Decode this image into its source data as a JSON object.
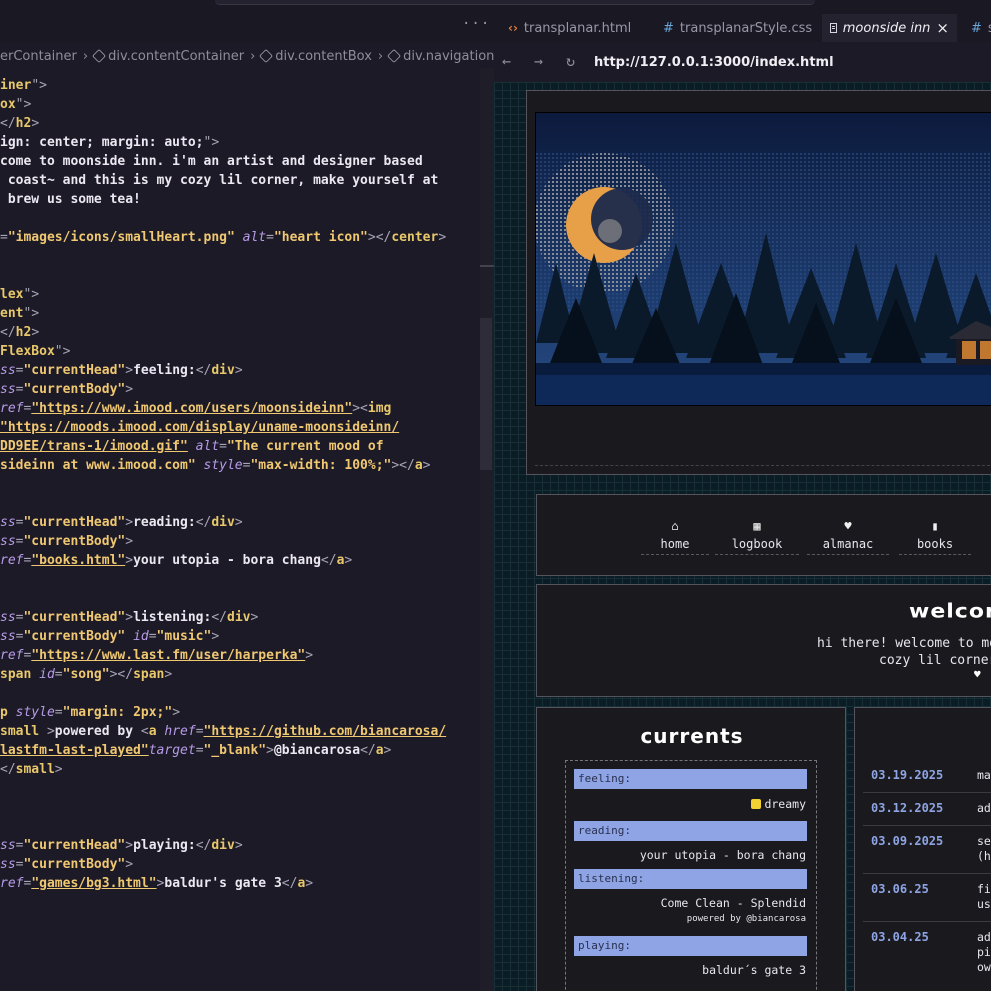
{
  "tabs": {
    "more": "···",
    "items": [
      {
        "label": "transplanar.html",
        "icon": "html-file-icon"
      },
      {
        "label": "transplanarStyle.css",
        "icon": "css-file-icon"
      },
      {
        "label": "moonside inn",
        "icon": "preview-icon",
        "active": true
      },
      {
        "label": "s",
        "icon": "css-file-icon"
      }
    ]
  },
  "breadcrumb": [
    "erContainer",
    "div.contentContainer",
    "div.contentBox",
    "div.navigation",
    "c"
  ],
  "editor": {
    "lines": [
      [
        {
          "k": "t",
          "v": "iner"
        },
        {
          "k": "p",
          "v": "\">"
        }
      ],
      [
        {
          "k": "t",
          "v": "ox"
        },
        {
          "k": "p",
          "v": "\">"
        }
      ],
      [
        {
          "k": "p",
          "v": "</"
        },
        {
          "k": "t",
          "v": "h2"
        },
        {
          "k": "p",
          "v": ">"
        }
      ],
      [
        {
          "k": "x",
          "v": "ign: center; margin: auto;"
        },
        {
          "k": "p",
          "v": "\">"
        }
      ],
      [
        {
          "k": "x",
          "v": "come to moonside inn. i'm an artist and designer based"
        }
      ],
      [
        {
          "k": "x",
          "v": " coast~ and this is my cozy lil corner, make yourself at"
        }
      ],
      [
        {
          "k": "x",
          "v": " brew us some tea!"
        }
      ],
      [
        {
          "k": "p",
          "v": "="
        },
        {
          "k": "s",
          "v": "\"images/icons/smallHeart.png\""
        },
        {
          "k": "x",
          "v": " "
        },
        {
          "k": "a",
          "v": "alt"
        },
        {
          "k": "p",
          "v": "="
        },
        {
          "k": "s",
          "v": "\"heart icon\""
        },
        {
          "k": "p",
          "v": "></"
        },
        {
          "k": "t",
          "v": "center"
        },
        {
          "k": "p",
          "v": ">"
        }
      ],
      [
        {
          "k": "t",
          "v": "lex"
        },
        {
          "k": "p",
          "v": "\">"
        }
      ],
      [
        {
          "k": "t",
          "v": "ent"
        },
        {
          "k": "p",
          "v": "\">"
        }
      ],
      [
        {
          "k": "p",
          "v": "</"
        },
        {
          "k": "t",
          "v": "h2"
        },
        {
          "k": "p",
          "v": ">"
        }
      ],
      [
        {
          "k": "t",
          "v": "FlexBox"
        },
        {
          "k": "p",
          "v": "\">"
        }
      ],
      [
        {
          "k": "a",
          "v": "ss"
        },
        {
          "k": "p",
          "v": "="
        },
        {
          "k": "s",
          "v": "\"currentHead\""
        },
        {
          "k": "p",
          "v": ">"
        },
        {
          "k": "x",
          "v": "feeling:"
        },
        {
          "k": "p",
          "v": "</"
        },
        {
          "k": "t",
          "v": "div"
        },
        {
          "k": "p",
          "v": ">"
        }
      ],
      [
        {
          "k": "a",
          "v": "ss"
        },
        {
          "k": "p",
          "v": "="
        },
        {
          "k": "s",
          "v": "\"currentBody\""
        },
        {
          "k": "p",
          "v": ">"
        }
      ],
      [
        {
          "k": "a",
          "v": "ref"
        },
        {
          "k": "p",
          "v": "="
        },
        {
          "k": "u",
          "v": "\"https://www.imood.com/users/moonsideinn\""
        },
        {
          "k": "p",
          "v": "><"
        },
        {
          "k": "t",
          "v": "img"
        }
      ],
      [
        {
          "k": "u",
          "v": "\"https://moods.imood.com/display/uname-moonsideinn/"
        }
      ],
      [
        {
          "k": "u",
          "v": "DD9EE/trans-1/imood.gif\""
        },
        {
          "k": "x",
          "v": " "
        },
        {
          "k": "a",
          "v": "alt"
        },
        {
          "k": "p",
          "v": "="
        },
        {
          "k": "s",
          "v": "\"The current mood of"
        }
      ],
      [
        {
          "k": "s",
          "v": "sideinn at www.imood.com\""
        },
        {
          "k": "x",
          "v": " "
        },
        {
          "k": "a",
          "v": "style"
        },
        {
          "k": "p",
          "v": "="
        },
        {
          "k": "s",
          "v": "\"max-width: 100%;\""
        },
        {
          "k": "p",
          "v": "></"
        },
        {
          "k": "t",
          "v": "a"
        },
        {
          "k": "p",
          "v": ">"
        }
      ],
      [
        {
          "k": "a",
          "v": "ss"
        },
        {
          "k": "p",
          "v": "="
        },
        {
          "k": "s",
          "v": "\"currentHead\""
        },
        {
          "k": "p",
          "v": ">"
        },
        {
          "k": "x",
          "v": "reading:"
        },
        {
          "k": "p",
          "v": "</"
        },
        {
          "k": "t",
          "v": "div"
        },
        {
          "k": "p",
          "v": ">"
        }
      ],
      [
        {
          "k": "a",
          "v": "ss"
        },
        {
          "k": "p",
          "v": "="
        },
        {
          "k": "s",
          "v": "\"currentBody\""
        },
        {
          "k": "p",
          "v": ">"
        }
      ],
      [
        {
          "k": "a",
          "v": "ref"
        },
        {
          "k": "p",
          "v": "="
        },
        {
          "k": "u",
          "v": "\"books.html\""
        },
        {
          "k": "p",
          "v": ">"
        },
        {
          "k": "x",
          "v": "your utopia - bora chang"
        },
        {
          "k": "p",
          "v": "</"
        },
        {
          "k": "t",
          "v": "a"
        },
        {
          "k": "p",
          "v": ">"
        }
      ],
      [
        {
          "k": "a",
          "v": "ss"
        },
        {
          "k": "p",
          "v": "="
        },
        {
          "k": "s",
          "v": "\"currentHead\""
        },
        {
          "k": "p",
          "v": ">"
        },
        {
          "k": "x",
          "v": "listening:"
        },
        {
          "k": "p",
          "v": "</"
        },
        {
          "k": "t",
          "v": "div"
        },
        {
          "k": "p",
          "v": ">"
        }
      ],
      [
        {
          "k": "a",
          "v": "ss"
        },
        {
          "k": "p",
          "v": "="
        },
        {
          "k": "s",
          "v": "\"currentBody\""
        },
        {
          "k": "x",
          "v": " "
        },
        {
          "k": "a",
          "v": "id"
        },
        {
          "k": "p",
          "v": "="
        },
        {
          "k": "s",
          "v": "\"music\""
        },
        {
          "k": "p",
          "v": ">"
        }
      ],
      [
        {
          "k": "a",
          "v": "ref"
        },
        {
          "k": "p",
          "v": "="
        },
        {
          "k": "u",
          "v": "\"https://www.last.fm/user/harperka\""
        },
        {
          "k": "p",
          "v": ">"
        }
      ],
      [
        {
          "k": "t",
          "v": "span"
        },
        {
          "k": "x",
          "v": " "
        },
        {
          "k": "a",
          "v": "id"
        },
        {
          "k": "p",
          "v": "="
        },
        {
          "k": "s",
          "v": "\"song\""
        },
        {
          "k": "p",
          "v": "></"
        },
        {
          "k": "t",
          "v": "span"
        },
        {
          "k": "p",
          "v": ">"
        }
      ],
      [
        {
          "k": "t",
          "v": "p"
        },
        {
          "k": "x",
          "v": " "
        },
        {
          "k": "a",
          "v": "style"
        },
        {
          "k": "p",
          "v": "="
        },
        {
          "k": "s",
          "v": "\"margin: 2px;\""
        },
        {
          "k": "p",
          "v": ">"
        }
      ],
      [
        {
          "k": "t",
          "v": "small"
        },
        {
          "k": "x",
          "v": " "
        },
        {
          "k": "p",
          "v": ">"
        },
        {
          "k": "x",
          "v": "powered by "
        },
        {
          "k": "p",
          "v": "<"
        },
        {
          "k": "t",
          "v": "a"
        },
        {
          "k": "x",
          "v": " "
        },
        {
          "k": "a",
          "v": "href"
        },
        {
          "k": "p",
          "v": "="
        },
        {
          "k": "u",
          "v": "\"https://github.com/biancarosa/"
        }
      ],
      [
        {
          "k": "u",
          "v": "lastfm-last-played\""
        },
        {
          "k": "a",
          "v": "target"
        },
        {
          "k": "p",
          "v": "="
        },
        {
          "k": "s",
          "v": "\"_blank\""
        },
        {
          "k": "p",
          "v": ">"
        },
        {
          "k": "x",
          "v": "@biancarosa"
        },
        {
          "k": "p",
          "v": "</"
        },
        {
          "k": "t",
          "v": "a"
        },
        {
          "k": "p",
          "v": ">"
        }
      ],
      [
        {
          "k": "p",
          "v": "</"
        },
        {
          "k": "t",
          "v": "small"
        },
        {
          "k": "p",
          "v": ">"
        }
      ],
      [
        {
          "k": "a",
          "v": "ss"
        },
        {
          "k": "p",
          "v": "="
        },
        {
          "k": "s",
          "v": "\"currentHead\""
        },
        {
          "k": "p",
          "v": ">"
        },
        {
          "k": "x",
          "v": "playing:"
        },
        {
          "k": "p",
          "v": "</"
        },
        {
          "k": "t",
          "v": "div"
        },
        {
          "k": "p",
          "v": ">"
        }
      ],
      [
        {
          "k": "a",
          "v": "ss"
        },
        {
          "k": "p",
          "v": "="
        },
        {
          "k": "s",
          "v": "\"currentBody\""
        },
        {
          "k": "p",
          "v": ">"
        }
      ],
      [
        {
          "k": "a",
          "v": "ref"
        },
        {
          "k": "p",
          "v": "="
        },
        {
          "k": "u",
          "v": "\"games/bg3.html\""
        },
        {
          "k": "p",
          "v": ">"
        },
        {
          "k": "x",
          "v": "baldur's gate 3"
        },
        {
          "k": "p",
          "v": "</"
        },
        {
          "k": "t",
          "v": "a"
        },
        {
          "k": "p",
          "v": ">"
        }
      ]
    ]
  },
  "browser": {
    "back": "←",
    "forward": "→",
    "reload": "↻",
    "url": "http://127.0.0.1:3000/index.html"
  },
  "site": {
    "nav": [
      {
        "label": "home",
        "icon": "home-icon",
        "glyph": "⌂"
      },
      {
        "label": "logbook",
        "icon": "calendar-icon",
        "glyph": "▦"
      },
      {
        "label": "almanac",
        "icon": "heart-icon",
        "glyph": "♥"
      },
      {
        "label": "books",
        "icon": "book-icon",
        "glyph": "▮"
      }
    ],
    "welcome": {
      "title": "welcom",
      "line1": "hi there! welcome to moonside inn. i´m an artist and",
      "line2": "cozy lil corner, make yourself at",
      "heart": "♥"
    },
    "currents": {
      "title": "currents",
      "feeling_head": "feeling:",
      "feeling_body": "dreamy",
      "reading_head": "reading:",
      "reading_body": "your utopia - bora chang",
      "listening_head": "listening:",
      "listening_body": "Come Clean - Splendid",
      "powered": "powered by @biancarosa",
      "playing_head": "playing:",
      "playing_body": "baldur´s gate 3"
    },
    "log": [
      {
        "date": "03.19.2025",
        "text": "ma"
      },
      {
        "date": "03.12.2025",
        "text": "ad"
      },
      {
        "date": "03.09.2025",
        "text": "se\n(h"
      },
      {
        "date": "03.06.25",
        "text": "fi\nus"
      },
      {
        "date": "03.04.25",
        "text": "ad\npi\now"
      }
    ]
  },
  "colors": {
    "accent_blue": "#8ea4e4",
    "tag_yellow": "#e8c86a",
    "attr_purple": "#b79be8",
    "grid_teal": "#173038"
  }
}
